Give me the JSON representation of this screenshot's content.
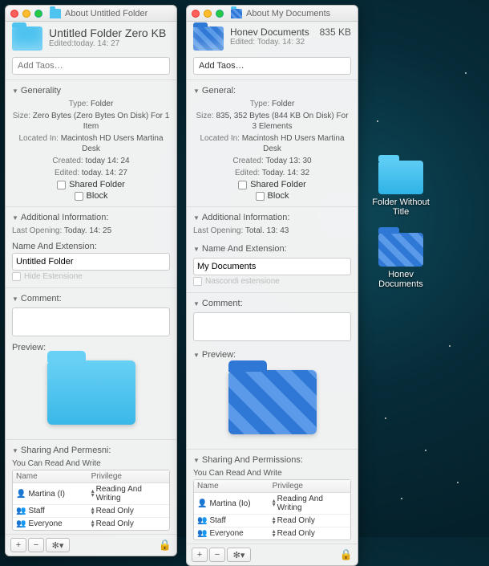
{
  "desktop": {
    "icons": [
      {
        "label": "Folder Without Title"
      },
      {
        "label": "Honev Documents"
      }
    ]
  },
  "win1": {
    "title": "About Untitled Folder",
    "header": {
      "name": "Untitled Folder Zero KB",
      "sub": "Edited:today. 14: 27"
    },
    "tags_placeholder": "Add Taos…",
    "general": {
      "header": "Generality",
      "type_lbl": "Type:",
      "type_val": "Folder",
      "size_lbl": "Size:",
      "size_val": "Zero Bytes (Zero Bytes On Disk) For 1 Item",
      "located_lbl": "Located In:",
      "located_val": "Macintosh HD Users Martina Desk",
      "created_lbl": "Created:",
      "created_val": "today 14: 24",
      "edited_lbl": "Edited:",
      "edited_val": "today. 14: 27",
      "shared_lbl": "Shared Folder",
      "block_lbl": "Block"
    },
    "addl": {
      "header": "Additional Information:",
      "last_lbl": "Last Opening:",
      "last_val": "Today. 14: 25"
    },
    "name_ext": {
      "header": "Name And Extension:",
      "value": "Untitled Folder",
      "hide_lbl": "Hide Estensione"
    },
    "comment_header": "Comment:",
    "preview_header": "Preview:",
    "perms": {
      "header": "Sharing And Permesni:",
      "summary": "You Can Read And Write",
      "col_name": "Name",
      "col_priv": "Privilege",
      "rows": [
        {
          "name": "Martina (I)",
          "priv": "Reading And Writing"
        },
        {
          "name": "Staff",
          "priv": "Read Only"
        },
        {
          "name": "Everyone",
          "priv": "Read Only"
        }
      ]
    },
    "footer": {
      "add": "+",
      "remove": "−",
      "gear": "✻▾",
      "lock": "🔒"
    }
  },
  "win2": {
    "title": "About My Documents",
    "header": {
      "name": "Honev Documents",
      "size": "835 KB",
      "sub": "Edited: Today. 14: 32"
    },
    "tags_placeholder": "Add Taos…",
    "general": {
      "header": "General:",
      "type_lbl": "Type:",
      "type_val": "Folder",
      "size_lbl": "Size:",
      "size_val": "835, 352 Bytes (844 KB On Disk) For 3 Elements",
      "located_lbl": "Located In:",
      "located_val": "Macintosh HD Users Martina Desk",
      "created_lbl": "Created:",
      "created_val": "Today 13: 30",
      "edited_lbl": "Edited:",
      "edited_val": "Today. 14: 32",
      "shared_lbl": "Shared Folder",
      "block_lbl": "Block"
    },
    "addl": {
      "header": "Additional Information:",
      "last_lbl": "Last Opening:",
      "last_val": "Total. 13: 43"
    },
    "name_ext": {
      "header": "Name And Extension:",
      "value": "My Documents",
      "hide_lbl": "Nascondi estensione"
    },
    "comment_header": "Comment:",
    "preview_header": "Preview:",
    "perms": {
      "header": "Sharing And Permissions:",
      "summary": "You Can Read And Write",
      "col_name": "Name",
      "col_priv": "Privilege",
      "rows": [
        {
          "name": "Martina (Io)",
          "priv": "Reading And Writing"
        },
        {
          "name": "Staff",
          "priv": "Read Only"
        },
        {
          "name": "Everyone",
          "priv": "Read Only"
        }
      ]
    },
    "footer": {
      "add": "+",
      "remove": "−",
      "gear": "✻▾",
      "lock": "🔒"
    }
  }
}
